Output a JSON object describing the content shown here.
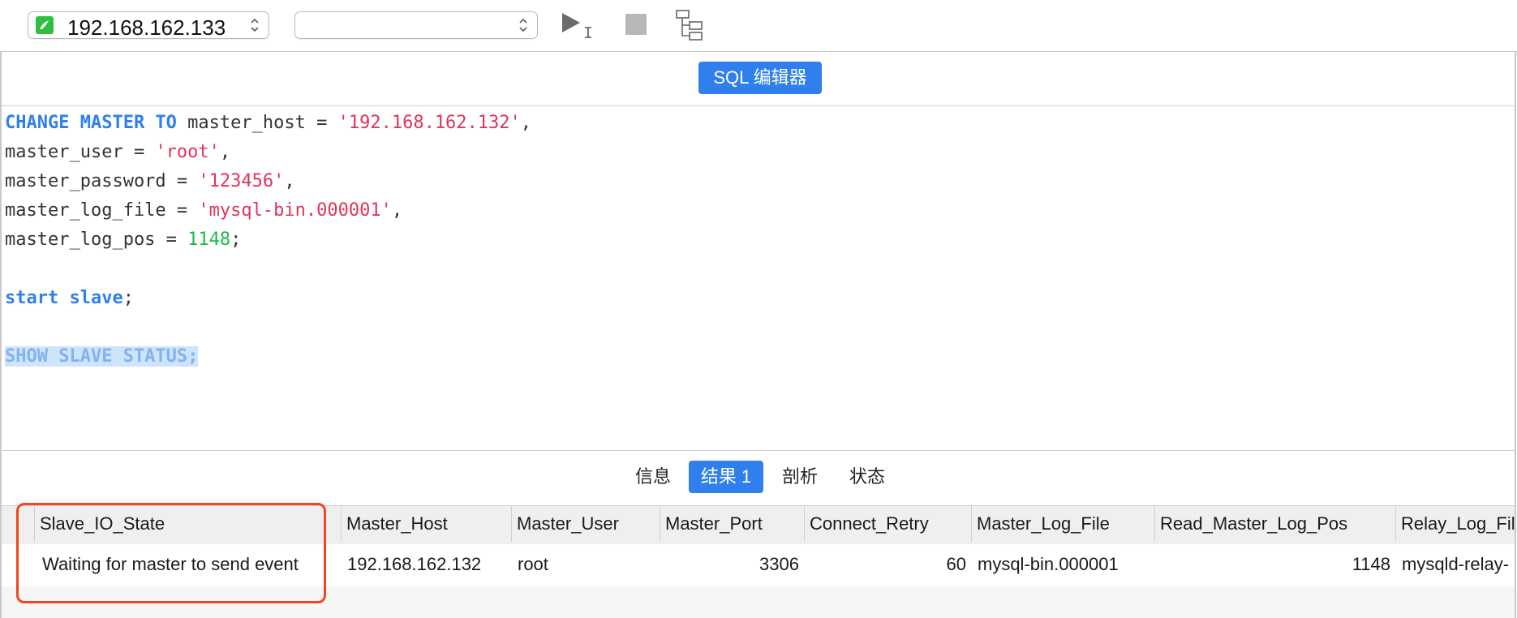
{
  "toolbar": {
    "connection": "192.168.162.133",
    "database": ""
  },
  "editor": {
    "tab_label": "SQL 编辑器"
  },
  "code": {
    "lines": [
      [
        {
          "t": "kw",
          "v": "CHANGE MASTER TO"
        },
        {
          "t": "plain",
          "v": " master_host = "
        },
        {
          "t": "str",
          "v": "'192.168.162.132'"
        },
        {
          "t": "plain",
          "v": ","
        }
      ],
      [
        {
          "t": "plain",
          "v": "master_user = "
        },
        {
          "t": "str",
          "v": "'root'"
        },
        {
          "t": "plain",
          "v": ","
        }
      ],
      [
        {
          "t": "plain",
          "v": "master_password = "
        },
        {
          "t": "str",
          "v": "'123456'"
        },
        {
          "t": "plain",
          "v": ","
        }
      ],
      [
        {
          "t": "plain",
          "v": "master_log_file = "
        },
        {
          "t": "str",
          "v": "'mysql-bin.000001'"
        },
        {
          "t": "plain",
          "v": ","
        }
      ],
      [
        {
          "t": "plain",
          "v": "master_log_pos = "
        },
        {
          "t": "num",
          "v": "1148"
        },
        {
          "t": "plain",
          "v": ";"
        }
      ],
      [],
      [
        {
          "t": "kw",
          "v": "start slave"
        },
        {
          "t": "plain",
          "v": ";"
        }
      ],
      [],
      [
        {
          "t": "hl",
          "v": "SHOW SLAVE STATUS;"
        }
      ]
    ]
  },
  "result_tabs": {
    "info": "信息",
    "result1": "结果 1",
    "profile": "剖析",
    "status": "状态"
  },
  "grid": {
    "columns": [
      "Slave_IO_State",
      "Master_Host",
      "Master_User",
      "Master_Port",
      "Connect_Retry",
      "Master_Log_File",
      "Read_Master_Log_Pos",
      "Relay_Log_File"
    ],
    "row": [
      "Waiting for master to send event",
      "192.168.162.132",
      "root",
      "3306",
      "60",
      "mysql-bin.000001",
      "1148",
      "mysqld-relay-"
    ]
  },
  "colors": {
    "accent": "#2f80ed",
    "highlight_box": "#f0461f",
    "string": "#e0345b",
    "number": "#1cb84f"
  }
}
